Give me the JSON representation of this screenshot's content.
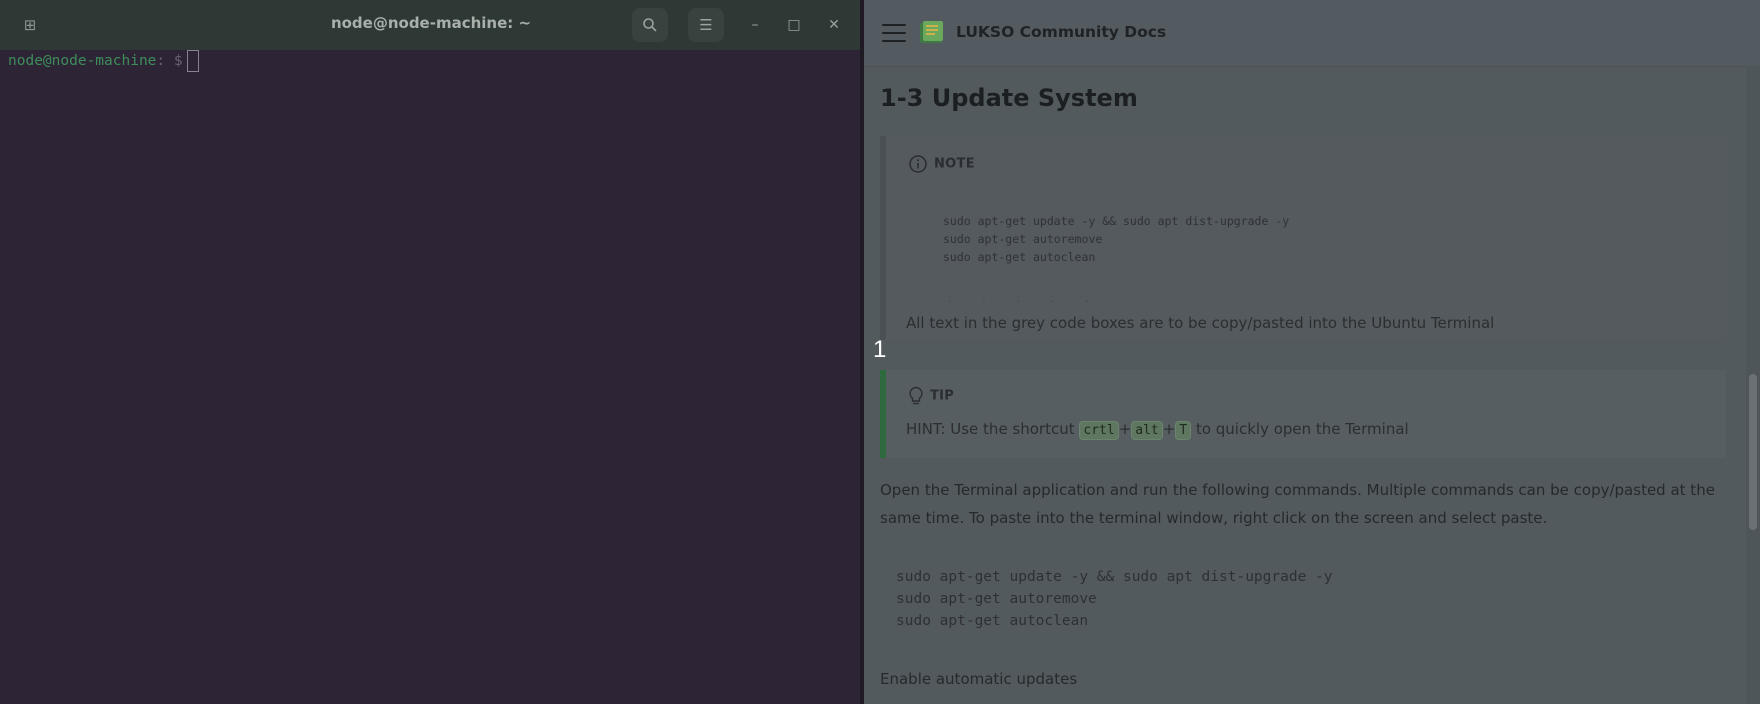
{
  "terminal": {
    "title": "node@node-machine: ~",
    "new_tab_icon": "new-tab-icon",
    "prompt_user": "node@node-machine",
    "prompt_path": ": $",
    "window_buttons": [
      "search-icon",
      "menu-icon",
      "minimize-icon",
      "maximize-icon",
      "close-icon"
    ],
    "glyphs": {
      "newtab": "⊞",
      "search": "⌕",
      "menu": "☰",
      "minimize": "–",
      "maximize": "□",
      "close": "✕"
    }
  },
  "docs": {
    "site_title": "LUKSO Community Docs",
    "page_title": "1-3 Update System",
    "note": {
      "label": "NOTE",
      "code": "sudo apt-get update -y && sudo apt dist-upgrade -y\nsudo apt-get autoremove\nsudo apt-get autoclean",
      "dots": ". . . . .",
      "text": "All text in the grey code boxes are to be copy/pasted into the Ubuntu Terminal"
    },
    "tip": {
      "label": "TIP",
      "before": "HINT: Use the shortcut ",
      "keys": [
        "crtl",
        "alt",
        "T"
      ],
      "plus": "+",
      "after": " to quickly open the Terminal"
    },
    "paragraph": "Open the Terminal application and run the following commands. Multiple commands can be copy/pasted at the same time. To paste into the terminal window, right click on the screen and select paste.",
    "code": "sudo apt-get update -y && sudo apt dist-upgrade -y\nsudo apt-get autoremove\nsudo apt-get autoclean",
    "enable_text": "Enable automatic updates"
  },
  "overlay_number": "1",
  "colors": {
    "terminal_bg": "#2d2435",
    "docs_bg": "#535a5e",
    "tip_border": "#2f6a3e",
    "prompt_green": "#3d8e5a"
  }
}
